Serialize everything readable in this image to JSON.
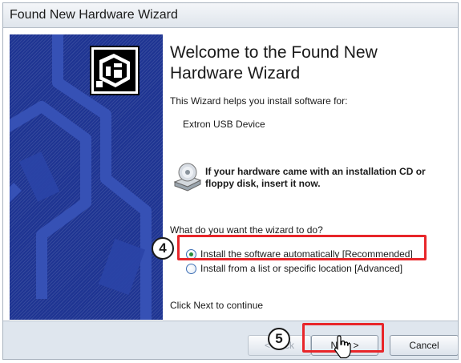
{
  "window": {
    "title": "Found New Hardware Wizard"
  },
  "content": {
    "heading": "Welcome to the Found New Hardware Wizard",
    "intro": "This Wizard helps you install software for:",
    "device": "Extron USB Device",
    "cd_prompt": "If your hardware came with an installation CD or floppy disk, insert it now.",
    "question": "What do you want the wizard to do?",
    "options": [
      {
        "label": "Install the software automatically [Recommended]",
        "selected": true
      },
      {
        "label": "Install from a list or specific location [Advanced]",
        "selected": false
      }
    ],
    "continue_text": "Click Next to continue"
  },
  "buttons": {
    "back": "< Back",
    "next": "Next >",
    "cancel": "Cancel"
  },
  "annotations": {
    "step4": "4",
    "step5": "5"
  },
  "colors": {
    "highlight": "#e8262a",
    "side_panel": "#1e3492"
  }
}
